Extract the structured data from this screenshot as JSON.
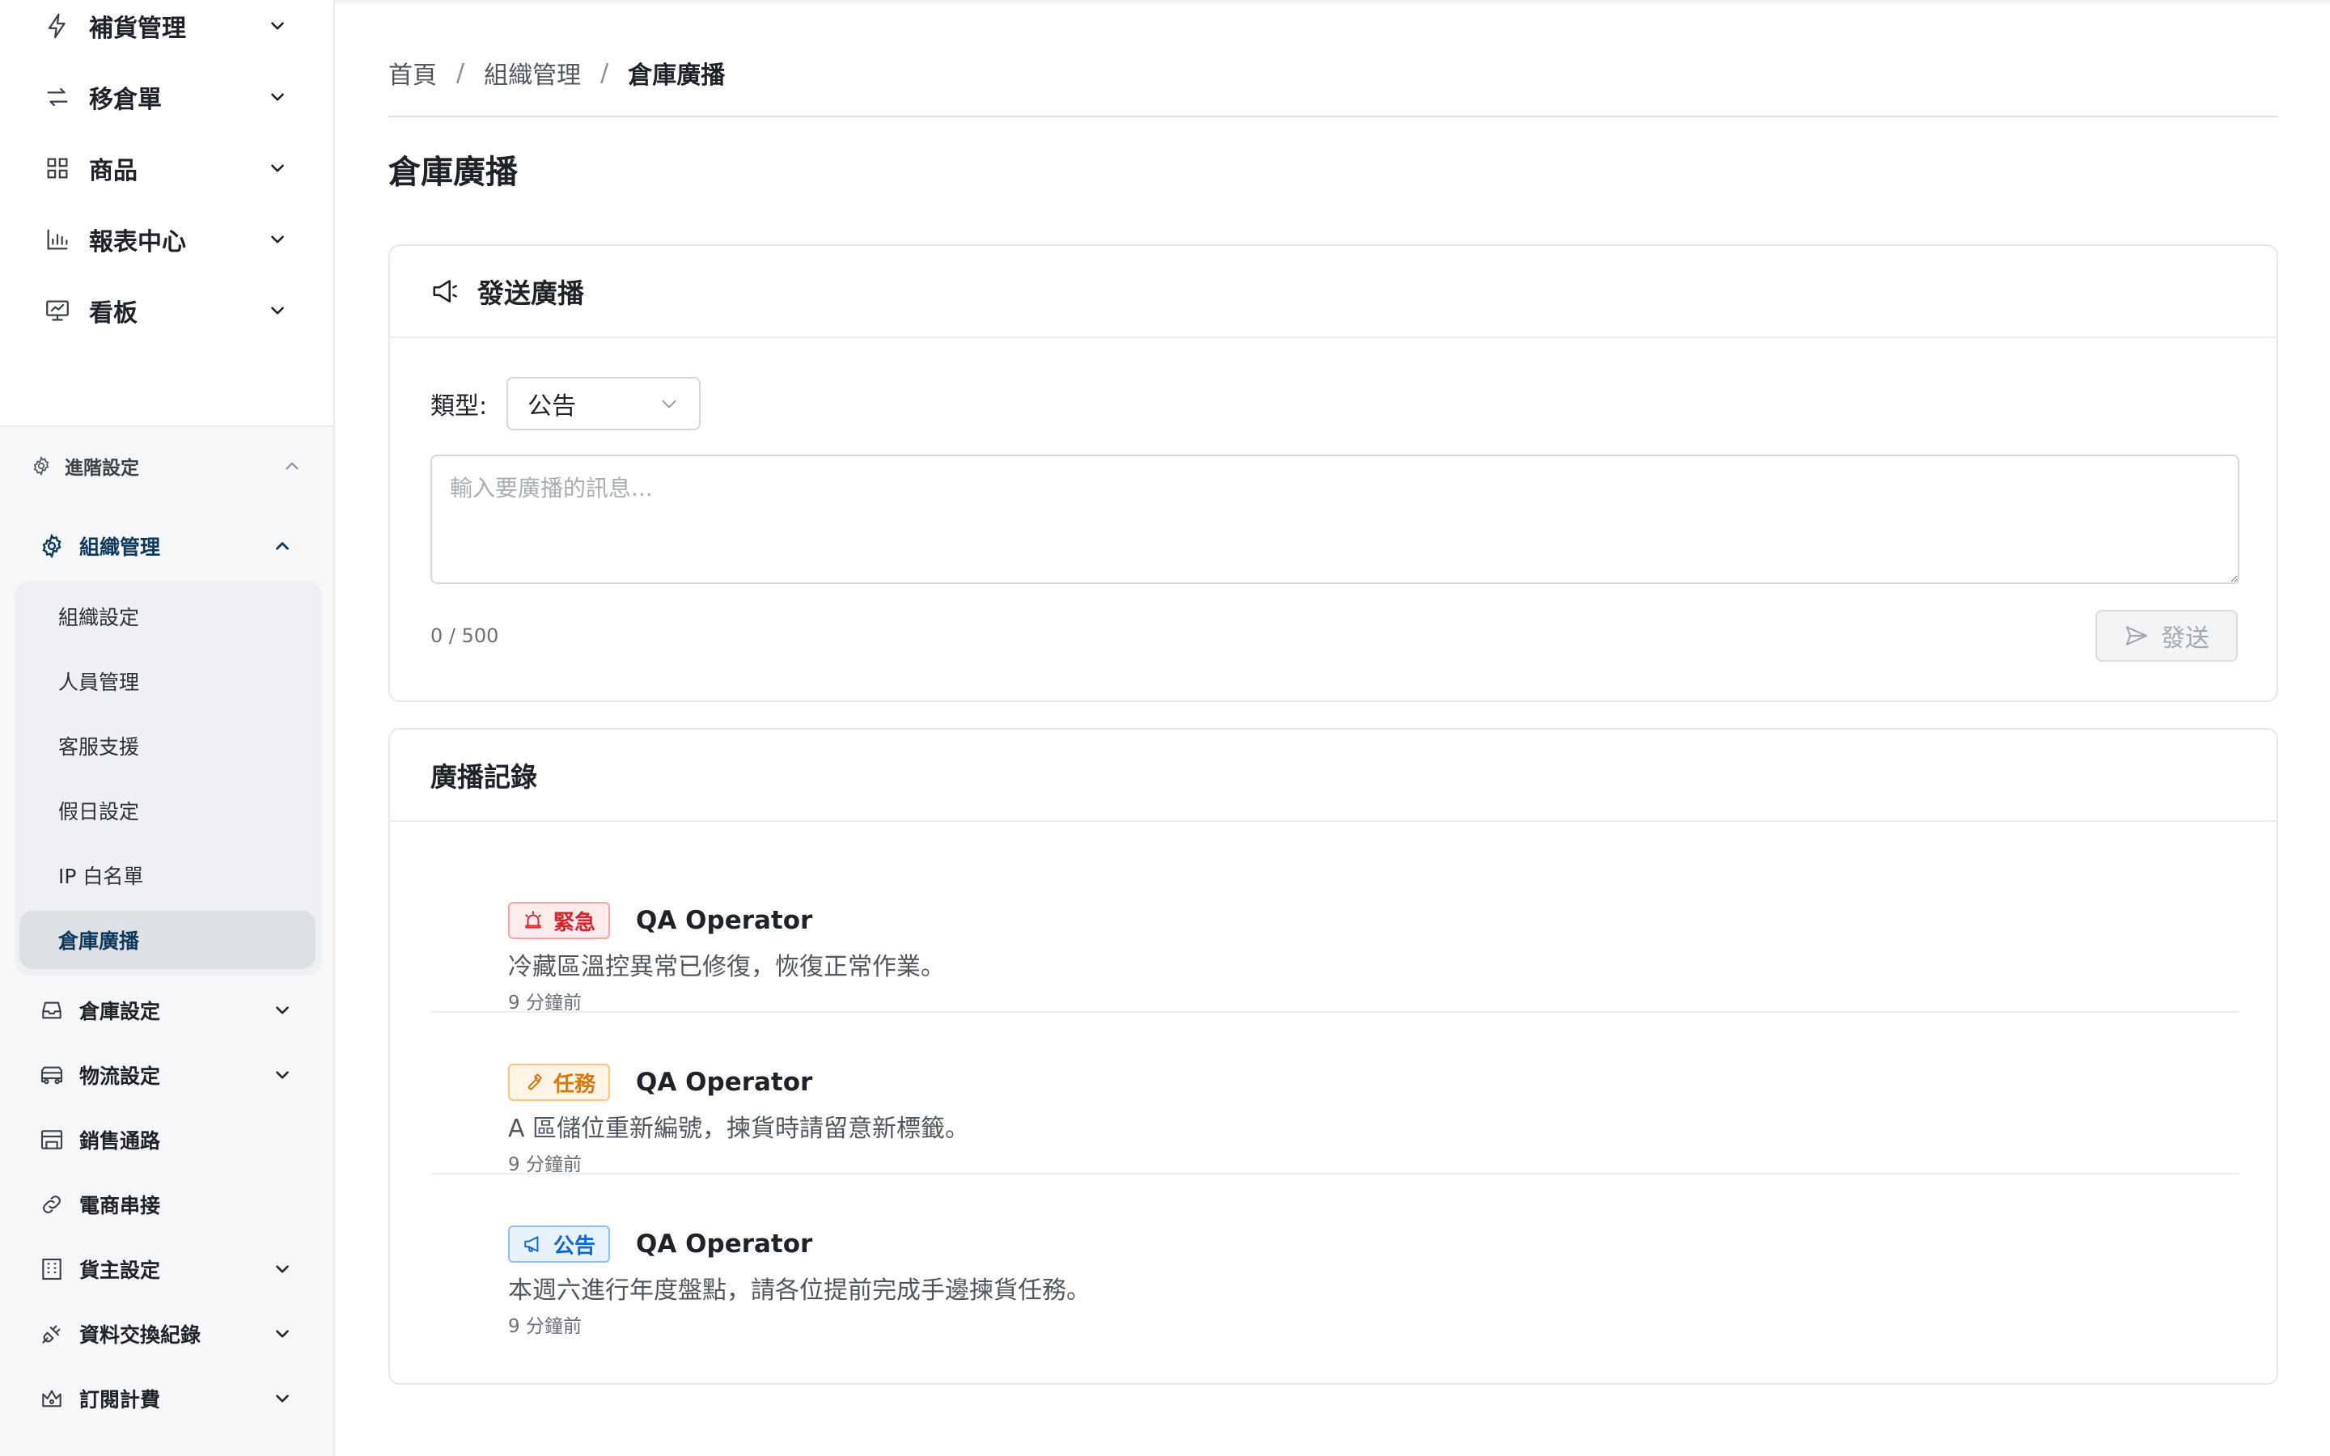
{
  "sidebar": {
    "top_items": [
      {
        "label": "補貨管理",
        "icon": "lightning-icon"
      },
      {
        "label": "移倉單",
        "icon": "transfer-arrows-icon"
      },
      {
        "label": "商品",
        "icon": "grid-icon"
      },
      {
        "label": "報表中心",
        "icon": "bar-chart-icon"
      },
      {
        "label": "看板",
        "icon": "presentation-board-icon"
      }
    ],
    "advanced": {
      "label": "進階設定",
      "icon": "gear-icon"
    },
    "org": {
      "label": "組織管理",
      "icon": "gear-icon",
      "sub_items": [
        "組織設定",
        "人員管理",
        "客服支援",
        "假日設定",
        "IP 白名單",
        "倉庫廣播"
      ],
      "active_sub": "倉庫廣播"
    },
    "bottom_items": [
      {
        "label": "倉庫設定",
        "icon": "inbox-icon",
        "has_chevron": true
      },
      {
        "label": "物流設定",
        "icon": "truck-icon",
        "has_chevron": true
      },
      {
        "label": "銷售通路",
        "icon": "store-icon",
        "has_chevron": false
      },
      {
        "label": "電商串接",
        "icon": "link-icon",
        "has_chevron": false
      },
      {
        "label": "貨主設定",
        "icon": "building-icon",
        "has_chevron": true
      },
      {
        "label": "資料交換紀錄",
        "icon": "plug-icon",
        "has_chevron": true
      },
      {
        "label": "訂閱計費",
        "icon": "crown-icon",
        "has_chevron": true
      }
    ]
  },
  "breadcrumb": [
    "首頁",
    "組織管理",
    "倉庫廣播"
  ],
  "page_title": "倉庫廣播",
  "send_card": {
    "title": "發送廣播",
    "type_label": "類型:",
    "type_value": "公告",
    "placeholder": "輸入要廣播的訊息...",
    "counter": "0 / 500",
    "send_label": "發送"
  },
  "records_card": {
    "title": "廣播記錄",
    "records": [
      {
        "tag": "緊急",
        "tag_kind": "urgent",
        "author": "QA Operator",
        "message": "冷藏區溫控異常已修復，恢復正常作業。",
        "time": "9 分鐘前"
      },
      {
        "tag": "任務",
        "tag_kind": "task",
        "author": "QA Operator",
        "message": "A 區儲位重新編號，揀貨時請留意新標籤。",
        "time": "9 分鐘前"
      },
      {
        "tag": "公告",
        "tag_kind": "notice",
        "author": "QA Operator",
        "message": "本週六進行年度盤點，請各位提前完成手邊揀貨任務。",
        "time": "9 分鐘前"
      }
    ]
  },
  "colors": {
    "urgent": "#d4242c",
    "task": "#d97708",
    "notice": "#1468c8",
    "active_nav": "#0d3a5c"
  }
}
